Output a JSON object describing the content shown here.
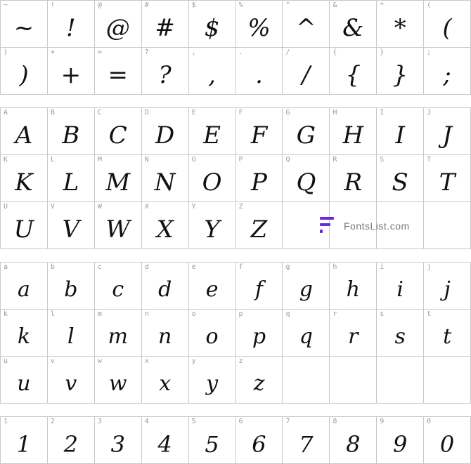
{
  "sections": {
    "symbols": {
      "rows": [
        [
          {
            "cap": "~",
            "glyph": "~"
          },
          {
            "cap": "!",
            "glyph": "!"
          },
          {
            "cap": "@",
            "glyph": "@"
          },
          {
            "cap": "#",
            "glyph": "#"
          },
          {
            "cap": "$",
            "glyph": "$"
          },
          {
            "cap": "%",
            "glyph": "%"
          },
          {
            "cap": "^",
            "glyph": "^"
          },
          {
            "cap": "&",
            "glyph": "&"
          },
          {
            "cap": "*",
            "glyph": "*"
          },
          {
            "cap": "(",
            "glyph": "("
          }
        ],
        [
          {
            "cap": ")",
            "glyph": ")"
          },
          {
            "cap": "+",
            "glyph": "+"
          },
          {
            "cap": "=",
            "glyph": "="
          },
          {
            "cap": "?",
            "glyph": "?"
          },
          {
            "cap": ",",
            "glyph": ","
          },
          {
            "cap": ".",
            "glyph": "."
          },
          {
            "cap": "/",
            "glyph": "/"
          },
          {
            "cap": "{",
            "glyph": "{"
          },
          {
            "cap": "}",
            "glyph": "}"
          },
          {
            "cap": ";",
            "glyph": ";"
          }
        ]
      ]
    },
    "uppercase": {
      "rows": [
        [
          {
            "cap": "A",
            "glyph": "A"
          },
          {
            "cap": "B",
            "glyph": "B"
          },
          {
            "cap": "C",
            "glyph": "C"
          },
          {
            "cap": "D",
            "glyph": "D"
          },
          {
            "cap": "E",
            "glyph": "E"
          },
          {
            "cap": "F",
            "glyph": "F"
          },
          {
            "cap": "G",
            "glyph": "G"
          },
          {
            "cap": "H",
            "glyph": "H"
          },
          {
            "cap": "I",
            "glyph": "I"
          },
          {
            "cap": "J",
            "glyph": "J"
          }
        ],
        [
          {
            "cap": "K",
            "glyph": "K"
          },
          {
            "cap": "L",
            "glyph": "L"
          },
          {
            "cap": "M",
            "glyph": "M"
          },
          {
            "cap": "N",
            "glyph": "N"
          },
          {
            "cap": "O",
            "glyph": "O"
          },
          {
            "cap": "P",
            "glyph": "P"
          },
          {
            "cap": "Q",
            "glyph": "Q"
          },
          {
            "cap": "R",
            "glyph": "R"
          },
          {
            "cap": "S",
            "glyph": "S"
          },
          {
            "cap": "T",
            "glyph": "T"
          }
        ],
        [
          {
            "cap": "U",
            "glyph": "U"
          },
          {
            "cap": "V",
            "glyph": "V"
          },
          {
            "cap": "W",
            "glyph": "W"
          },
          {
            "cap": "X",
            "glyph": "X"
          },
          {
            "cap": "Y",
            "glyph": "Y"
          },
          {
            "cap": "Z",
            "glyph": "Z"
          },
          {
            "cap": "",
            "glyph": ""
          },
          {
            "cap": "",
            "glyph": ""
          },
          {
            "cap": "",
            "glyph": ""
          },
          {
            "cap": "",
            "glyph": ""
          }
        ]
      ]
    },
    "lowercase": {
      "rows": [
        [
          {
            "cap": "a",
            "glyph": "a"
          },
          {
            "cap": "b",
            "glyph": "b"
          },
          {
            "cap": "c",
            "glyph": "c"
          },
          {
            "cap": "d",
            "glyph": "d"
          },
          {
            "cap": "e",
            "glyph": "e"
          },
          {
            "cap": "f",
            "glyph": "f"
          },
          {
            "cap": "g",
            "glyph": "g"
          },
          {
            "cap": "h",
            "glyph": "h"
          },
          {
            "cap": "i",
            "glyph": "i"
          },
          {
            "cap": "j",
            "glyph": "j"
          }
        ],
        [
          {
            "cap": "k",
            "glyph": "k"
          },
          {
            "cap": "l",
            "glyph": "l"
          },
          {
            "cap": "m",
            "glyph": "m"
          },
          {
            "cap": "n",
            "glyph": "n"
          },
          {
            "cap": "o",
            "glyph": "o"
          },
          {
            "cap": "p",
            "glyph": "p"
          },
          {
            "cap": "q",
            "glyph": "q"
          },
          {
            "cap": "r",
            "glyph": "r"
          },
          {
            "cap": "s",
            "glyph": "s"
          },
          {
            "cap": "t",
            "glyph": "t"
          }
        ],
        [
          {
            "cap": "u",
            "glyph": "u"
          },
          {
            "cap": "v",
            "glyph": "v"
          },
          {
            "cap": "w",
            "glyph": "w"
          },
          {
            "cap": "x",
            "glyph": "x"
          },
          {
            "cap": "y",
            "glyph": "y"
          },
          {
            "cap": "z",
            "glyph": "z"
          },
          {
            "cap": "",
            "glyph": ""
          },
          {
            "cap": "",
            "glyph": ""
          },
          {
            "cap": "",
            "glyph": ""
          },
          {
            "cap": "",
            "glyph": ""
          }
        ]
      ]
    },
    "digits": {
      "rows": [
        [
          {
            "cap": "1",
            "glyph": "1"
          },
          {
            "cap": "2",
            "glyph": "2"
          },
          {
            "cap": "3",
            "glyph": "3"
          },
          {
            "cap": "4",
            "glyph": "4"
          },
          {
            "cap": "5",
            "glyph": "5"
          },
          {
            "cap": "6",
            "glyph": "6"
          },
          {
            "cap": "7",
            "glyph": "7"
          },
          {
            "cap": "8",
            "glyph": "8"
          },
          {
            "cap": "9",
            "glyph": "9"
          },
          {
            "cap": "0",
            "glyph": "0"
          }
        ]
      ]
    }
  },
  "watermark": {
    "text": "FontsList.com",
    "icon": "fontslist-logo-icon",
    "accent_color": "#6a2bdc"
  }
}
